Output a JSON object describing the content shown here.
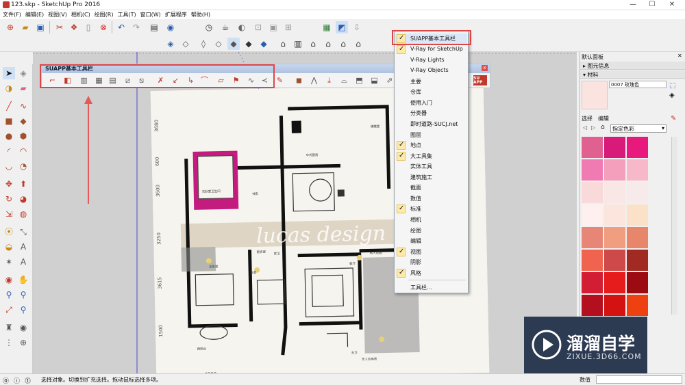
{
  "window": {
    "title": "123.skp - SketchUp Pro 2016",
    "min": "—",
    "max": "☐",
    "close": "✕"
  },
  "menubar": [
    "文件(F)",
    "编辑(E)",
    "视图(V)",
    "相机(C)",
    "绘图(R)",
    "工具(T)",
    "窗口(W)",
    "扩展程序",
    "帮助(H)"
  ],
  "suapp_toolbar": {
    "title": "SUAPP基本工具栏",
    "close": "x",
    "logo": "SU APP"
  },
  "context_menu": {
    "items": [
      {
        "label": "SUAPP基本工具栏",
        "checked": true
      },
      {
        "label": "V-Ray for SketchUp",
        "checked": true
      },
      {
        "label": "V-Ray Lights",
        "checked": false
      },
      {
        "label": "V-Ray Objects",
        "checked": false
      },
      {
        "label": "主要",
        "checked": false
      },
      {
        "label": "仓库",
        "checked": false
      },
      {
        "label": "使用入门",
        "checked": false
      },
      {
        "label": "分类器",
        "checked": false
      },
      {
        "label": "即时道路-SUCJ.net",
        "checked": false
      },
      {
        "label": "图层",
        "checked": false
      },
      {
        "label": "地点",
        "checked": true
      },
      {
        "label": "大工具集",
        "checked": true
      },
      {
        "label": "实体工具",
        "checked": false
      },
      {
        "label": "建筑施工",
        "checked": false
      },
      {
        "label": "截面",
        "checked": false
      },
      {
        "label": "数值",
        "checked": false
      },
      {
        "label": "标准",
        "checked": true
      },
      {
        "label": "相机",
        "checked": false
      },
      {
        "label": "绘图",
        "checked": false
      },
      {
        "label": "编辑",
        "checked": false
      },
      {
        "label": "视图",
        "checked": true
      },
      {
        "label": "阴影",
        "checked": false
      },
      {
        "label": "风格",
        "checked": true
      },
      {
        "label": "工具栏...",
        "checked": false
      }
    ]
  },
  "plan": {
    "watermark": "lucas design",
    "dims_left": [
      "3680",
      "600",
      "3600",
      "3250",
      "3615",
      "1500"
    ],
    "dim_bottom": "4200",
    "room_labels": [
      "次卧室卫生间",
      "书房",
      "中式厨房",
      "客厅",
      "主卧室",
      "西阳台",
      "更衣室",
      "私人花园",
      "无人合库房",
      "家卫",
      "卧室",
      "储藏室",
      "主卫"
    ]
  },
  "right_panel": {
    "title": "默认面板",
    "entity_info": "▸ 图元信息",
    "materials": "▾ 材料",
    "material_name": "0007 玫瑰色",
    "tab_select": "选择",
    "tab_edit": "编辑",
    "dropdown": "指定色彩",
    "swatches": [
      "#e06090",
      "#d81b7a",
      "#e8197d",
      "#f07ab2",
      "#f4a0bd",
      "#f7b8c9",
      "#f9d9d9",
      "#f9e7e6",
      "#f6eaea",
      "#fdf0ee",
      "#fbe5dc",
      "#fbe1c7",
      "#e78577",
      "#f09d80",
      "#e8866c",
      "#f0634f",
      "#ce4a4a",
      "#a12a22",
      "#d21d35",
      "#e61b1b",
      "#9d0b12",
      "#b30f1f",
      "#d51212",
      "#ee4112"
    ],
    "selected_color": "#fbe3e0"
  },
  "status": {
    "text": "选择对象。切换到扩充选择。拖动鼠标选择多项。",
    "value_label": "数值"
  },
  "watermark_logo": {
    "main": "溜溜自学",
    "sub": "ZIXUE.3D66.COM"
  }
}
